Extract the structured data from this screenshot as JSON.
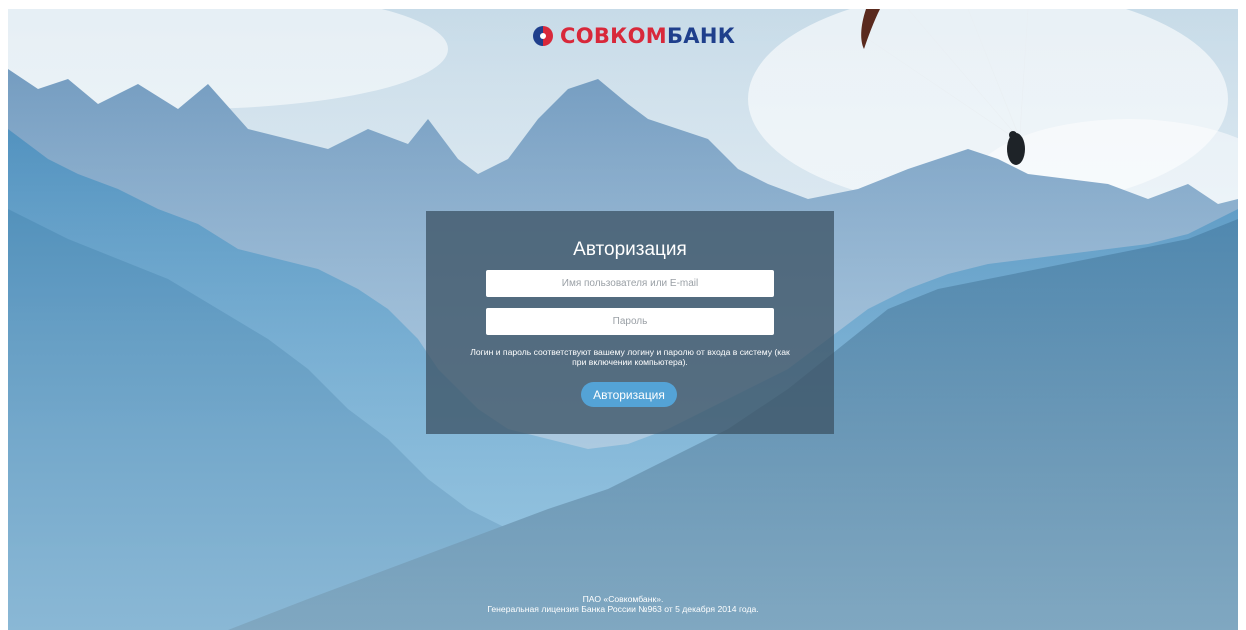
{
  "brand": {
    "name_part1": "СОВКОМ",
    "name_part2": "БАНК",
    "colors": {
      "red": "#d8283a",
      "blue": "#1f3f8c"
    },
    "icon": "sovcombank-logo-icon"
  },
  "auth": {
    "title": "Авторизация",
    "username_placeholder": "Имя пользователя или E-mail",
    "password_placeholder": "Пароль",
    "hint": "Логин и пароль соответствуют вашему логину и паролю от входа в систему (как при включении компьютера).",
    "submit_label": "Авторизация",
    "accent_color": "#54a3d6"
  },
  "footer": {
    "line1": "ПАО «Совкомбанк».",
    "line2": "Генеральная лицензия Банка России №963 от 5 декабря 2014 года."
  }
}
